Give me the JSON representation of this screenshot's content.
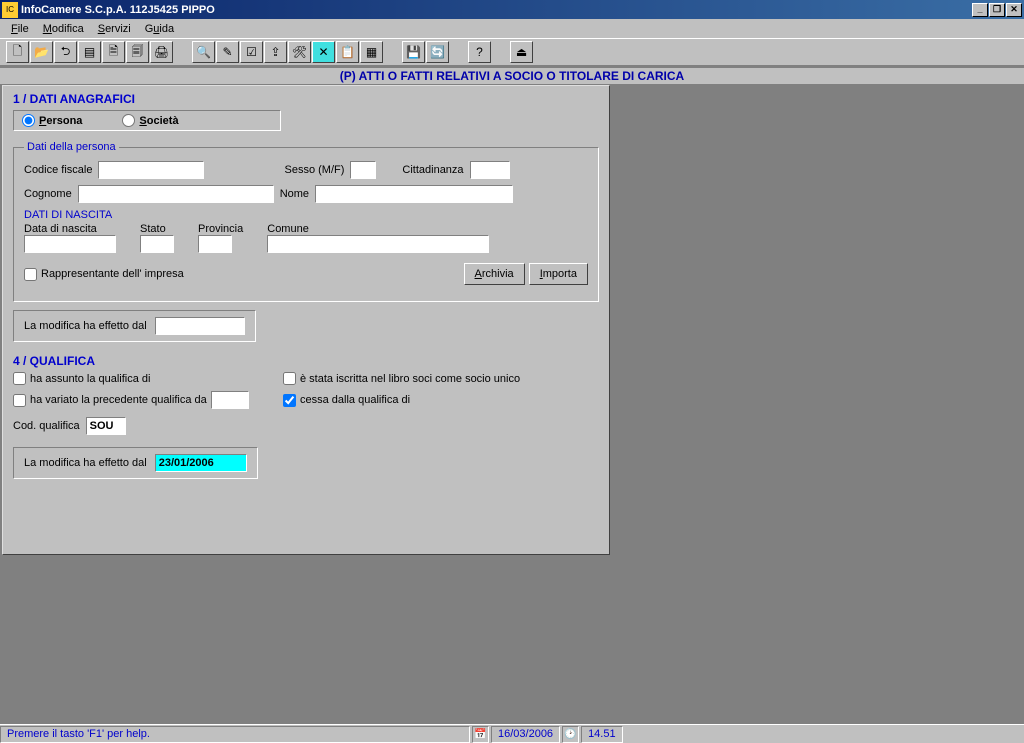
{
  "titlebar": {
    "title": "InfoCamere S.C.p.A. 112J5425 PIPPO"
  },
  "menus": {
    "file": "File",
    "modifica": "Modifica",
    "servizi": "Servizi",
    "guida": "Guida"
  },
  "banner": "(P)   ATTI O FATTI RELATIVI A SOCIO O TITOLARE DI CARICA",
  "sec1": {
    "header": "1 / DATI ANAGRAFICI",
    "radio_persona": "Persona",
    "radio_societa": "Società",
    "legend": "Dati della persona",
    "codice_fiscale_lbl": "Codice fiscale",
    "sesso_lbl": "Sesso (M/F)",
    "cittadinanza_lbl": "Cittadinanza",
    "cognome_lbl": "Cognome",
    "nome_lbl": "Nome",
    "nascita_hdr": "DATI DI NASCITA",
    "data_nascita_lbl": "Data di nascita",
    "stato_lbl": "Stato",
    "provincia_lbl": "Provincia",
    "comune_lbl": "Comune",
    "rappresentante_lbl": "Rappresentante dell' impresa",
    "archivia_btn": "Archivia",
    "importa_btn": "Importa",
    "effetto_lbl": "La modifica ha effetto dal",
    "values": {
      "codice_fiscale": "",
      "sesso": "",
      "cittadinanza": "",
      "cognome": "",
      "nome": "",
      "data_nascita": "",
      "stato": "",
      "provincia": "",
      "comune": "",
      "effetto": ""
    }
  },
  "sec4": {
    "header": "4 / QUALIFICA",
    "chk_assunto": "ha assunto la qualifica di",
    "chk_iscritta": "è stata iscritta nel libro soci come socio unico",
    "chk_variato": "ha variato la precedente qualifica da",
    "chk_cessa": "cessa dalla qualifica di",
    "cod_qualifica_lbl": "Cod. qualifica",
    "effetto_lbl": "La modifica ha effetto dal",
    "values": {
      "prev_qualifica": "",
      "cod_qualifica": "SOU",
      "effetto": "23/01/2006"
    }
  },
  "status": {
    "help": "Premere il tasto 'F1' per help.",
    "date": "16/03/2006",
    "time": "14.51"
  }
}
